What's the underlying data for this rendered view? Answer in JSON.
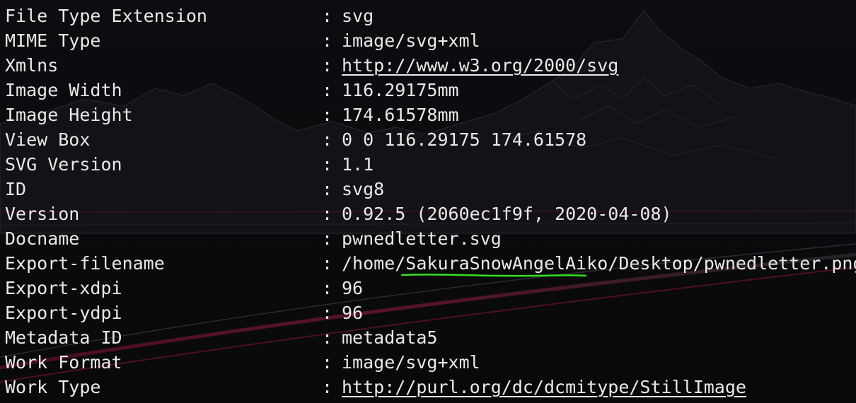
{
  "terminal": {
    "partial_top_line": "",
    "rows": [
      {
        "key": "File Type Extension",
        "sep": ":",
        "value": "svg",
        "link": false
      },
      {
        "key": "MIME Type",
        "sep": ":",
        "value": "image/svg+xml",
        "link": false
      },
      {
        "key": "Xmlns",
        "sep": ":",
        "value": "http://www.w3.org/2000/svg",
        "link": true
      },
      {
        "key": "Image Width",
        "sep": ":",
        "value": "116.29175mm",
        "link": false
      },
      {
        "key": "Image Height",
        "sep": ":",
        "value": "174.61578mm",
        "link": false
      },
      {
        "key": "View Box",
        "sep": ":",
        "value": "0 0 116.29175 174.61578",
        "link": false
      },
      {
        "key": "SVG Version",
        "sep": ":",
        "value": "1.1",
        "link": false
      },
      {
        "key": "ID",
        "sep": ":",
        "value": "svg8",
        "link": false
      },
      {
        "key": "Version",
        "sep": ":",
        "value": "0.92.5 (2060ec1f9f, 2020-04-08)",
        "link": false
      },
      {
        "key": "Docname",
        "sep": ":",
        "value": "pwnedletter.svg",
        "link": false
      },
      {
        "key": "Export-filename",
        "sep": ":",
        "value": "/home/SakuraSnowAngelAiko/Desktop/pwnedletter.png",
        "link": false
      },
      {
        "key": "Export-xdpi",
        "sep": ":",
        "value": "96",
        "link": false
      },
      {
        "key": "Export-ydpi",
        "sep": ":",
        "value": "96",
        "link": false
      },
      {
        "key": "Metadata ID",
        "sep": ":",
        "value": "metadata5",
        "link": false
      },
      {
        "key": "Work Format",
        "sep": ":",
        "value": "image/svg+xml",
        "link": false
      },
      {
        "key": "Work Type",
        "sep": ":",
        "value": "http://purl.org/dc/dcmitype/StillImage",
        "link": true
      }
    ]
  },
  "annotation": {
    "color": "#35e01f",
    "target_text": "SakuraSnowAngelAiko"
  },
  "colors": {
    "text": "#e9e9e9",
    "background": "#0c0c0f",
    "accent_streak": "#c2185b"
  }
}
